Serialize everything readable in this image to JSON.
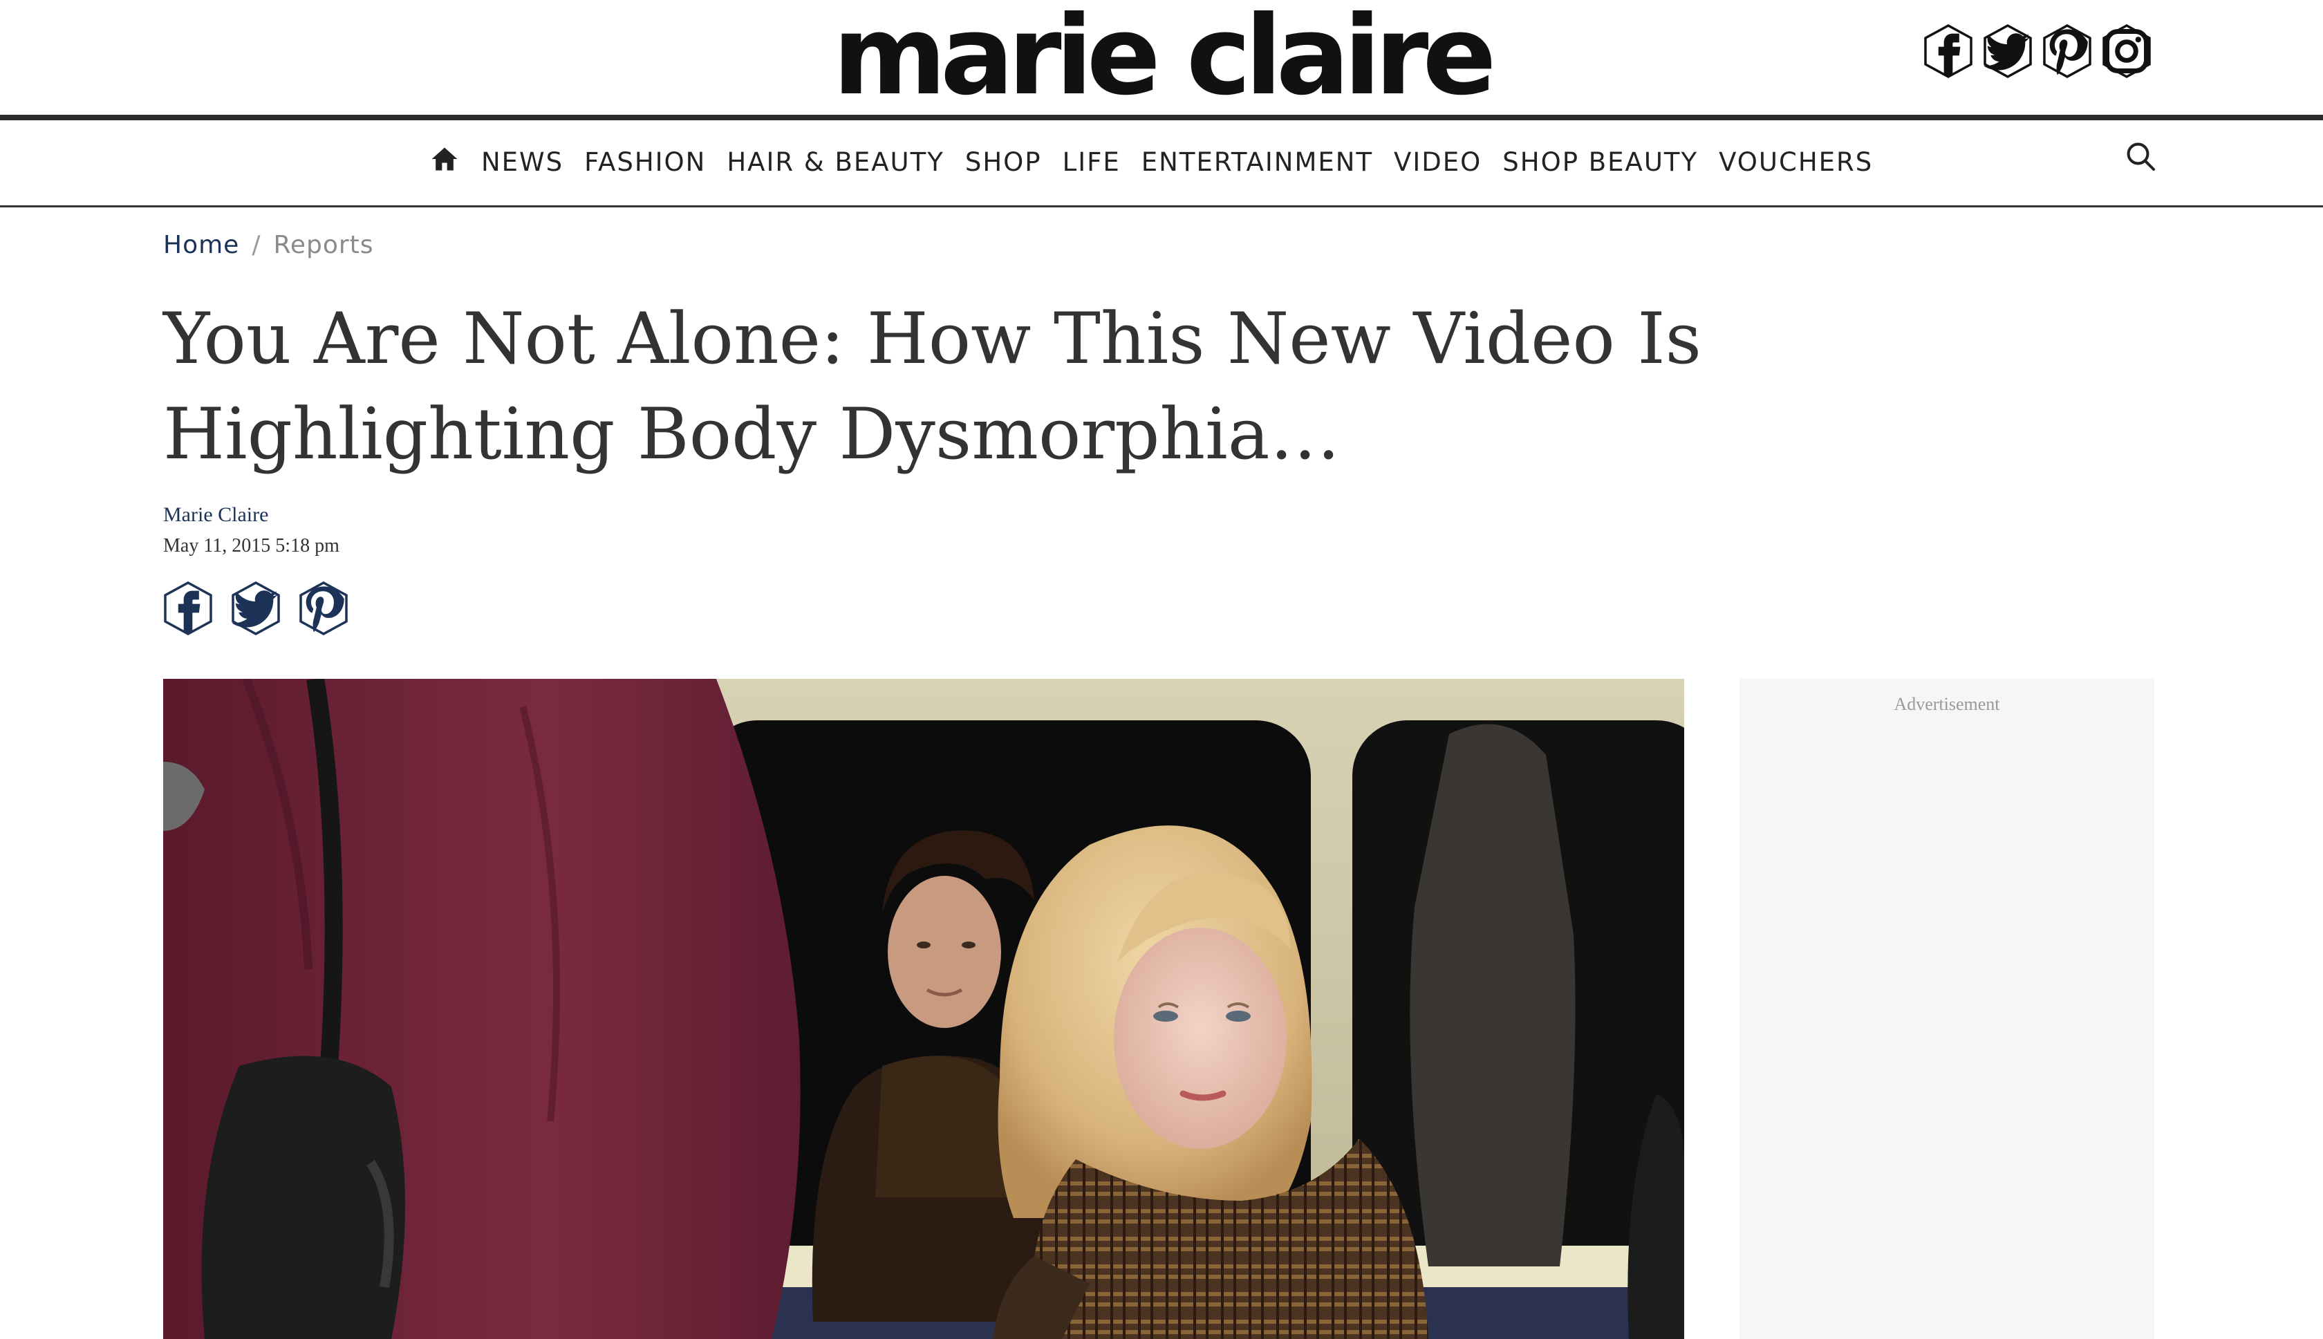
{
  "brand": {
    "logo_text": "marie claire"
  },
  "social_header": [
    {
      "icon": "facebook-icon",
      "glyph": "f"
    },
    {
      "icon": "twitter-icon",
      "glyph": "t"
    },
    {
      "icon": "pinterest-icon",
      "glyph": "p"
    },
    {
      "icon": "instagram-icon",
      "glyph": "ig"
    }
  ],
  "nav": {
    "home_icon": "home-icon",
    "items": [
      "NEWS",
      "FASHION",
      "HAIR & BEAUTY",
      "SHOP",
      "LIFE",
      "ENTERTAINMENT",
      "VIDEO",
      "SHOP BEAUTY",
      "VOUCHERS"
    ],
    "search_icon": "search-icon"
  },
  "breadcrumb": {
    "home": "Home",
    "separator": "/",
    "current": "Reports"
  },
  "article": {
    "title": "You Are Not Alone: How This New Video Is Highlighting Body Dysmorphia…",
    "author": "Marie Claire",
    "date": "May 11, 2015 5:18 pm",
    "share_icons": [
      "facebook-icon",
      "twitter-icon",
      "pinterest-icon"
    ]
  },
  "advertisement": {
    "label": "Advertisement"
  },
  "colors": {
    "brand_navy": "#1c3256",
    "text_dark": "#333333",
    "rule": "#2b2b2b",
    "ad_bg": "#f6f6f6"
  }
}
